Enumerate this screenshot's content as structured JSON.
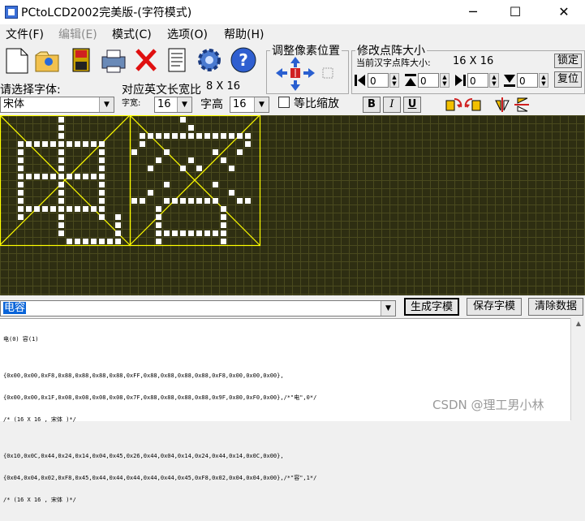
{
  "window": {
    "title": "PCtoLCD2002完美版-(字符模式)",
    "minimize": "─",
    "maximize": "☐",
    "close": "✕"
  },
  "menu": [
    "文件(F)",
    "编辑(E)",
    "模式(C)",
    "选项(O)",
    "帮助(H)"
  ],
  "adjust_group": {
    "title": "调整像素位置"
  },
  "resize_group": {
    "title": "修改点阵大小",
    "current_label": "当前汉字点阵大小:",
    "current_value": "16 X 16",
    "lock_button": "锁定",
    "reset_button": "复位",
    "spin_values": [
      "0",
      "0",
      "0",
      "0"
    ]
  },
  "font": {
    "select_label": "请选择字体:",
    "font_value": "宋体",
    "en_ratio_label": "对应英文长宽比",
    "en_ratio_value": "8 X 16",
    "width_label": "字宽:",
    "width_value": "16",
    "height_label": "字高",
    "height_value": "16",
    "scale_label": "等比缩放",
    "bold": "B",
    "italic": "I",
    "underline": "U"
  },
  "input": {
    "value": "电容",
    "generate_button": "生成字模",
    "save_button": "保存字模",
    "clear_button": "清除数据"
  },
  "output_lines": [
    "电(0) 容(1)",
    "",
    "{0x00,0x00,0xF8,0x88,0x88,0x88,0x88,0xFF,0x88,0x88,0x88,0x88,0xF8,0x00,0x00,0x00},",
    "{0x00,0x00,0x1F,0x08,0x08,0x08,0x08,0x7F,0x88,0x88,0x88,0x88,0x9F,0x80,0xF0,0x00},/*\"电\",0*/",
    "/* (16 X 16 , 宋体 )*/",
    "",
    "{0x10,0x0C,0x44,0x24,0x14,0x04,0x45,0x26,0x44,0x04,0x14,0x24,0x44,0x14,0x0C,0x00},",
    "{0x04,0x04,0x02,0xF8,0x45,0x44,0x44,0x44,0x44,0x44,0x45,0xF8,0x02,0x04,0x04,0x00},/*\"容\",1*/",
    "/* (16 X 16 , 宋体 )*/"
  ],
  "watermark": "CSDN @理工男小林",
  "colors": {
    "grid_bg": "#2e2e12",
    "grid_line": "#4a4a1e",
    "pixel_on": "#ffffff",
    "box": "#ffff00"
  }
}
